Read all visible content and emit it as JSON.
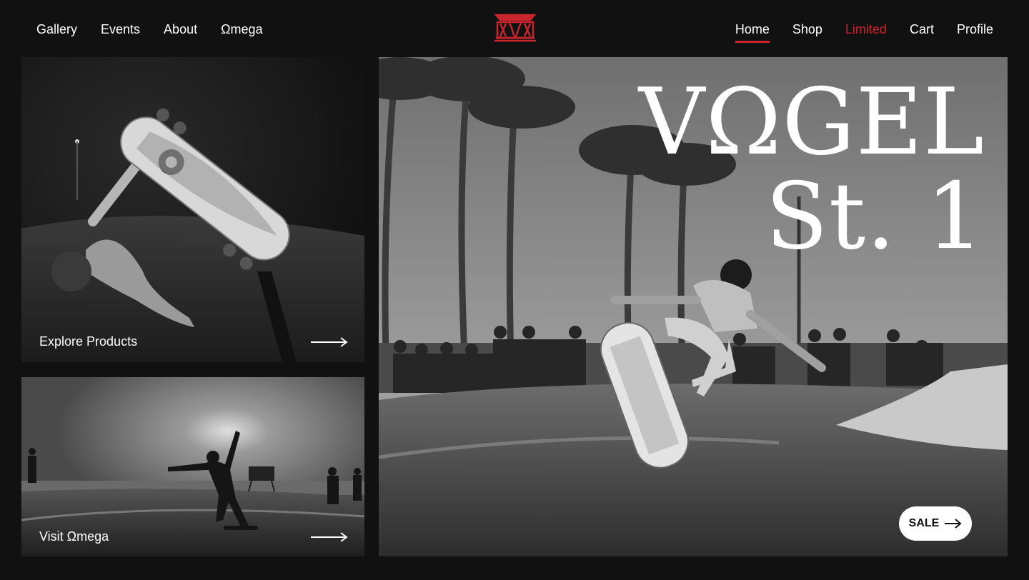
{
  "nav": {
    "left": [
      "Gallery",
      "Events",
      "About",
      "Ωmega"
    ],
    "right": [
      "Home",
      "Shop",
      "Limited",
      "Cart",
      "Profile"
    ],
    "active": "Home",
    "accent_item": "Limited"
  },
  "logo": {
    "icon": "temple-logo-icon",
    "color": "#c8262c"
  },
  "cards": {
    "top": {
      "label": "Explore Products",
      "arrow_icon": "long-arrow-right-icon"
    },
    "bottom": {
      "label": "Visit Ωmega",
      "arrow_icon": "long-arrow-right-icon"
    }
  },
  "hero": {
    "title_line1": "VΩGEL",
    "title_line2": "St. 1",
    "sale_label": "SALE",
    "sale_icon": "arrow-right-icon"
  },
  "colors": {
    "background": "#111111",
    "accent": "#c8262c",
    "text": "#ffffff"
  }
}
